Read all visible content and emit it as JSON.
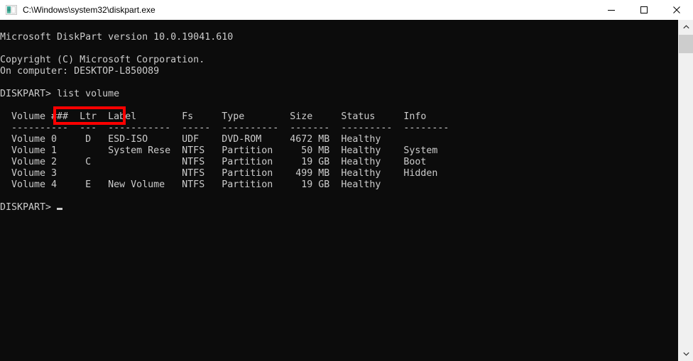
{
  "window": {
    "title": "C:\\Windows\\system32\\diskpart.exe",
    "icon": "console-window-icon",
    "background_color": "#0c0c0c",
    "text_color": "#cccccc",
    "titlebar_color": "#ffffff"
  },
  "caption_buttons": {
    "minimize_label": "Minimize",
    "maximize_label": "Maximize",
    "close_label": "Close"
  },
  "console": {
    "banner": [
      "Microsoft DiskPart version 10.0.19041.610",
      "",
      "Copyright (C) Microsoft Corporation.",
      "On computer: DESKTOP-L850O89"
    ],
    "prompt": "DISKPART>",
    "entered_command": "list volume",
    "trailing_prompt": "DISKPART>",
    "cursor": "_",
    "full_text": "Microsoft DiskPart version 10.0.19041.610\n\nCopyright (C) Microsoft Corporation.\nOn computer: DESKTOP-L850O89\n\nDISKPART> list volume\n\n  Volume ###  Ltr  Label        Fs     Type        Size     Status     Info\n  ----------  ---  -----------  -----  ----------  -------  ---------  --------\n  Volume 0     D   ESD-ISO      UDF    DVD-ROM     4672 MB  Healthy\n  Volume 1         System Rese  NTFS   Partition     50 MB  Healthy    System\n  Volume 2     C                NTFS   Partition     19 GB  Healthy    Boot\n  Volume 3                      NTFS   Partition    499 MB  Healthy    Hidden\n  Volume 4     E   New Volume   NTFS   Partition     19 GB  Healthy\n\nDISKPART>"
  },
  "volume_table": {
    "headers": [
      "Volume ###",
      "Ltr",
      "Label",
      "Fs",
      "Type",
      "Size",
      "Status",
      "Info"
    ],
    "separators": [
      "----------",
      "---",
      "-----------",
      "-----",
      "----------",
      "-------",
      "---------",
      "--------"
    ],
    "rows": [
      {
        "volume": "Volume 0",
        "ltr": "D",
        "label": "ESD-ISO",
        "fs": "UDF",
        "type": "DVD-ROM",
        "size": "4672 MB",
        "status": "Healthy",
        "info": ""
      },
      {
        "volume": "Volume 1",
        "ltr": "",
        "label": "System Rese",
        "fs": "NTFS",
        "type": "Partition",
        "size": "50 MB",
        "status": "Healthy",
        "info": "System"
      },
      {
        "volume": "Volume 2",
        "ltr": "C",
        "label": "",
        "fs": "NTFS",
        "type": "Partition",
        "size": "19 GB",
        "status": "Healthy",
        "info": "Boot"
      },
      {
        "volume": "Volume 3",
        "ltr": "",
        "label": "",
        "fs": "NTFS",
        "type": "Partition",
        "size": "499 MB",
        "status": "Healthy",
        "info": "Hidden"
      },
      {
        "volume": "Volume 4",
        "ltr": "E",
        "label": "New Volume",
        "fs": "NTFS",
        "type": "Partition",
        "size": "19 GB",
        "status": "Healthy",
        "info": ""
      }
    ]
  },
  "annotation": {
    "type": "rectangle-highlight",
    "target_text": "list volume",
    "color": "#fe0000"
  },
  "scrollbar": {
    "up_arrow": "chevron-up-icon",
    "down_arrow": "chevron-down-icon",
    "thumb_color": "#cdcdcd",
    "track_color": "#f0f0f0"
  }
}
